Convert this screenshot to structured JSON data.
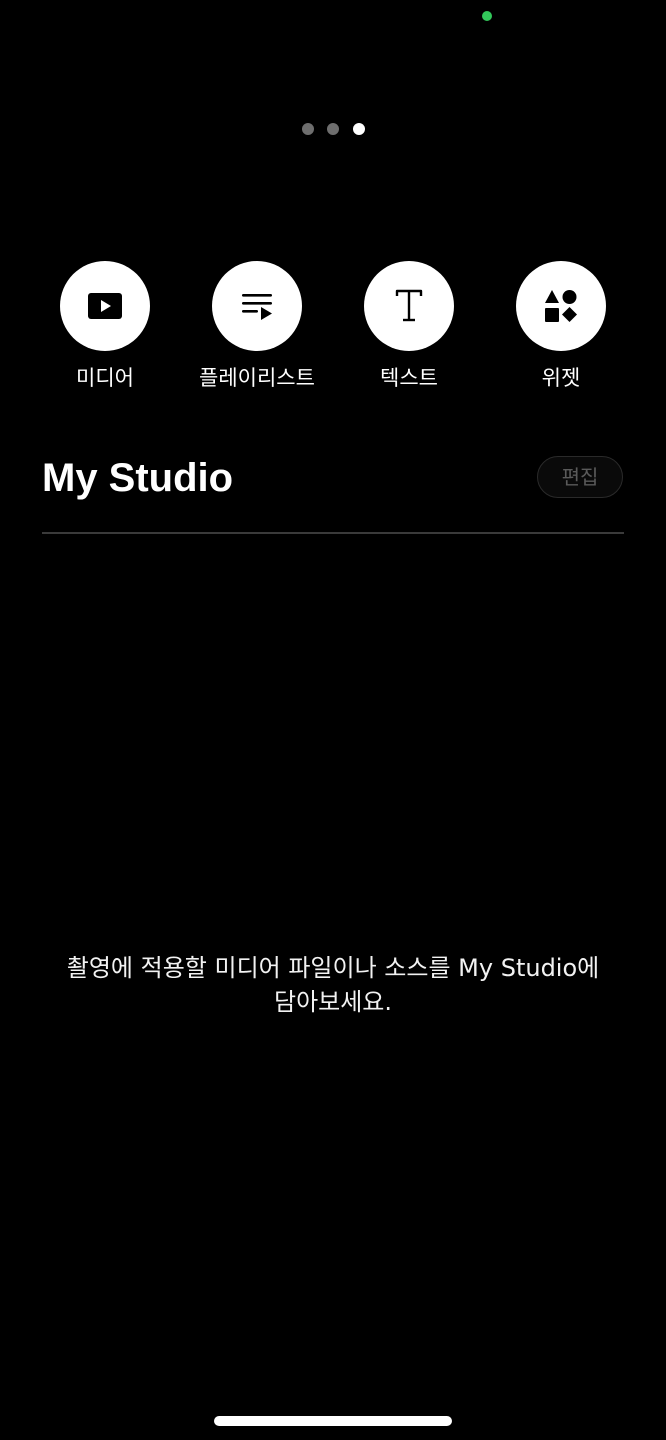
{
  "status_bar": {
    "indicator_color": "#32c85a"
  },
  "pager": {
    "page_count": 3,
    "current_page": 3
  },
  "quick_actions": [
    {
      "id": "media",
      "label": "미디어",
      "icon": "play-rectangle-icon"
    },
    {
      "id": "playlist",
      "label": "플레이리스트",
      "icon": "playlist-icon"
    },
    {
      "id": "text",
      "label": "텍스트",
      "icon": "text-t-icon"
    },
    {
      "id": "widget",
      "label": "위젯",
      "icon": "shapes-icon"
    }
  ],
  "studio": {
    "title": "My Studio",
    "edit_label": "편집",
    "empty_message": "촬영에 적용할 미디어 파일이나 소스를 My Studio에 담아보세요."
  },
  "colors": {
    "background": "#000000",
    "accent_green": "#32c85a",
    "text_primary": "#ffffff",
    "text_disabled": "#5a5a5a"
  }
}
